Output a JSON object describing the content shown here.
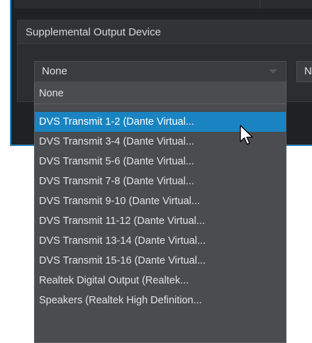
{
  "panel": {
    "title": "Supplemental Output Device"
  },
  "select": {
    "value": "None",
    "second_value": "N"
  },
  "dropdown": {
    "options": [
      "None",
      "DVS Transmit  1-2 (Dante Virtual...",
      "DVS Transmit  3-4 (Dante Virtual...",
      "DVS Transmit  5-6 (Dante Virtual...",
      "DVS Transmit  7-8 (Dante Virtual...",
      "DVS Transmit  9-10 (Dante Virtual...",
      "DVS Transmit 11-12 (Dante Virtual...",
      "DVS Transmit 13-14 (Dante Virtual...",
      "DVS Transmit 15-16 (Dante Virtual...",
      "Realtek Digital Output (Realtek...",
      "Speakers (Realtek High Definition..."
    ],
    "selected_index": 1
  },
  "colors": {
    "accent": "#1a84c2",
    "window_border": "#2b84b8",
    "dropdown_bg": "#4a4c4f"
  }
}
